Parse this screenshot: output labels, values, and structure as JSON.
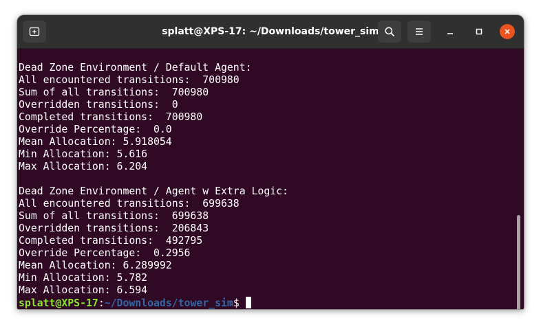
{
  "window": {
    "title": "splatt@XPS-17: ~/Downloads/tower_sim",
    "buttons": {
      "new_tab": "new-tab-icon",
      "search": "search-icon",
      "menu": "hamburger-menu-icon",
      "minimize": "minimize-icon",
      "maximize": "maximize-icon",
      "close": "close-icon"
    },
    "colors": {
      "titlebar": "#303030",
      "terminal_bg": "#300a24",
      "close_accent": "#e95420",
      "prompt_user": "#8ae234",
      "prompt_path": "#3465a4"
    }
  },
  "terminal": {
    "lines": [
      "Dead Zone Environment / Default Agent:",
      "All encountered transitions:  700980",
      "Sum of all transitions:  700980",
      "Overridden transitions:  0",
      "Completed transitions:  700980",
      "Override Percentage:  0.0",
      "Mean Allocation: 5.918054",
      "Min Allocation: 5.616",
      "Max Allocation: 6.204",
      "",
      "Dead Zone Environment / Agent w Extra Logic:",
      "All encountered transitions:  699638",
      "Sum of all transitions:  699638",
      "Overridden transitions:  206843",
      "Completed transitions:  492795",
      "Override Percentage:  0.2956",
      "Mean Allocation: 6.289992",
      "Min Allocation: 5.782",
      "Max Allocation: 6.594"
    ],
    "prompt": {
      "user_host": "splatt@XPS-17",
      "colon": ":",
      "path": "~/Downloads/tower_sim",
      "symbol": "$"
    }
  }
}
